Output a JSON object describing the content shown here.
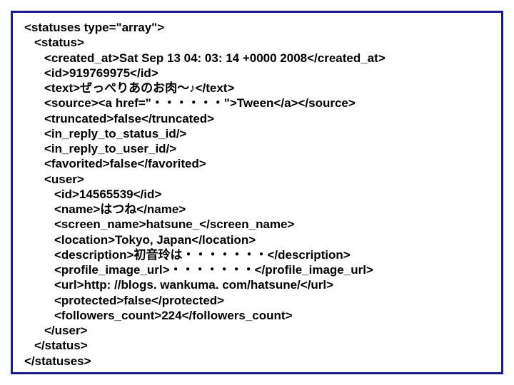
{
  "xml": {
    "l1": "<statuses type=\"array\">",
    "l2": "<status>",
    "l3": "<created_at>Sat Sep 13 04: 03: 14 +0000 2008</created_at>",
    "l4": "<id>919769975</id>",
    "l5": "<text>ぜっぺりあのお肉～♪</text>",
    "l6": "<source><a href=\"・・・・・・\">Tween</a></source>",
    "l7": "<truncated>false</truncated>",
    "l8": "<in_reply_to_status_id/>",
    "l9": "<in_reply_to_user_id/>",
    "l10": "<favorited>false</favorited>",
    "l11": "<user>",
    "l12": "<id>14565539</id>",
    "l13": "<name>はつね</name>",
    "l14": "<screen_name>hatsune_</screen_name>",
    "l15": "<location>Tokyo, Japan</location>",
    "l16": "<description>初音玲は・・・・・・・</description>",
    "l17": "<profile_image_url>・・・・・・・</profile_image_url>",
    "l18": "<url>http: //blogs. wankuma. com/hatsune/</url>",
    "l19": "<protected>false</protected>",
    "l20": "<followers_count>224</followers_count>",
    "l21": "</user>",
    "l22": "</status>",
    "l23": "</statuses>"
  }
}
